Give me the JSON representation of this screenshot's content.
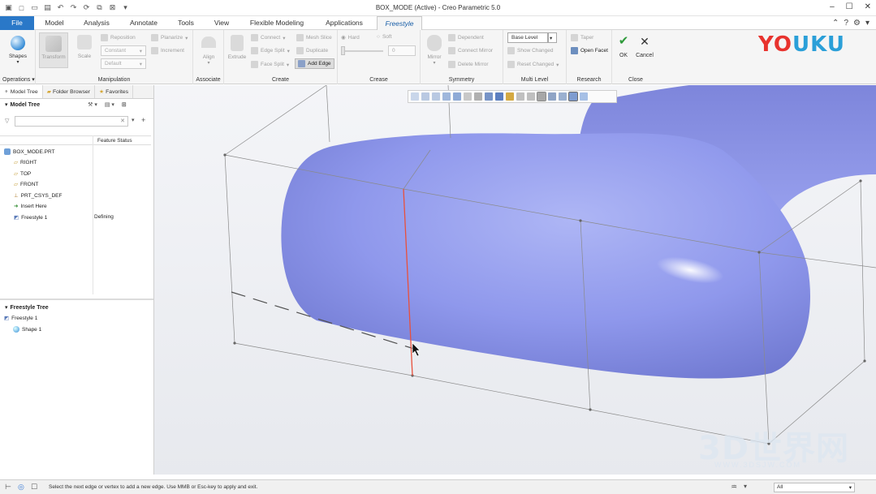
{
  "app": {
    "title": "BOX_MODE (Active) - Creo Parametric 5.0"
  },
  "menu_tabs": [
    {
      "label": "File"
    },
    {
      "label": "Model"
    },
    {
      "label": "Analysis"
    },
    {
      "label": "Annotate"
    },
    {
      "label": "Tools"
    },
    {
      "label": "View"
    },
    {
      "label": "Flexible Modeling"
    },
    {
      "label": "Applications"
    },
    {
      "label": "Freestyle"
    }
  ],
  "ribbon": {
    "operations": {
      "label": "Operations",
      "shapes": "Shapes"
    },
    "manipulation": {
      "label": "Manipulation",
      "transform": "Transform",
      "scale": "Scale",
      "reposition": "Reposition",
      "planarize": "Planarize",
      "constant": "Constant",
      "increment": "Increment",
      "default": "Default"
    },
    "associate": {
      "label": "Associate",
      "align": "Align"
    },
    "create": {
      "label": "Create",
      "extrude": "Extrude",
      "connect": "Connect",
      "edge_split": "Edge Split",
      "face_split": "Face Split",
      "mesh_slice": "Mesh Slice",
      "duplicate": "Duplicate",
      "add_edge": "Add Edge"
    },
    "crease": {
      "label": "Crease",
      "hard": "Hard",
      "soft": "Soft",
      "value": "0"
    },
    "symmetry": {
      "label": "Symmetry",
      "mirror": "Mirror",
      "dependent": "Dependent",
      "connect_mirror": "Connect Mirror",
      "delete_mirror": "Delete Mirror"
    },
    "multi_level": {
      "label": "Multi Level",
      "base_level": "Base Level",
      "show_changed": "Show Changed",
      "reset_changed": "Reset Changed"
    },
    "research": {
      "label": "Research",
      "taper": "Taper",
      "open_facet": "Open Facet"
    },
    "close": {
      "label": "Close",
      "ok": "OK",
      "cancel": "Cancel"
    }
  },
  "left_panel": {
    "tabs": [
      "Model Tree",
      "Folder Browser",
      "Favorites"
    ],
    "model_tree_title": "Model Tree",
    "column_status": "Feature Status",
    "items": [
      {
        "label": "BOX_MODE.PRT",
        "status": ""
      },
      {
        "label": "RIGHT",
        "status": ""
      },
      {
        "label": "TOP",
        "status": ""
      },
      {
        "label": "FRONT",
        "status": ""
      },
      {
        "label": "PRT_CSYS_DEF",
        "status": ""
      },
      {
        "label": "Insert Here",
        "status": ""
      },
      {
        "label": "Freestyle 1",
        "status": "Defining"
      }
    ],
    "freestyle_tree_title": "Freestyle Tree",
    "freestyle_items": [
      {
        "label": "Freestyle 1"
      },
      {
        "label": "Shape 1"
      }
    ]
  },
  "status": {
    "message": "Select the next edge or vertex to add a new edge. Use MMB or Esc-key to apply and exit.",
    "filter": "All"
  },
  "watermarks": {
    "youku": "YOUKU",
    "site": "3D世界网",
    "url": "WWW.3DSJW.COM"
  },
  "colors": {
    "file_tab": "#2a78c8",
    "shape_fill": "#8f98ec",
    "selected_edge": "#e8503c",
    "ok_check": "#2e9a3a"
  }
}
